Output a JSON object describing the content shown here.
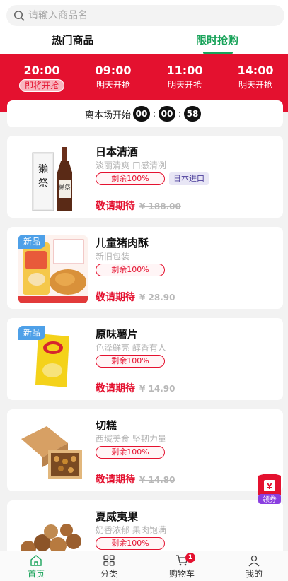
{
  "search": {
    "placeholder": "请输入商品名"
  },
  "tabs": [
    {
      "label": "热门商品"
    },
    {
      "label": "限时抢购"
    }
  ],
  "slots": [
    {
      "time": "20:00",
      "status": "即将开抢"
    },
    {
      "time": "09:00",
      "status": "明天开抢"
    },
    {
      "time": "11:00",
      "status": "明天开抢"
    },
    {
      "time": "14:00",
      "status": "明天开抢"
    }
  ],
  "countdown": {
    "label": "离本场开始",
    "hh": "00",
    "mm": "00",
    "ss": "58",
    "sep": ":"
  },
  "products": [
    {
      "name": "日本清酒",
      "desc": "淡丽清爽 口感清冽",
      "remain": "剩余100%",
      "extra_tag": "日本进口",
      "new_badge": "",
      "wait": "敬请期待",
      "price": "¥ 188.00"
    },
    {
      "name": "儿童猪肉酥",
      "desc": "新旧包装",
      "remain": "剩余100%",
      "extra_tag": "",
      "new_badge": "新品",
      "wait": "敬请期待",
      "price": "¥ 28.90"
    },
    {
      "name": "原味薯片",
      "desc": "色泽鲜亮 醇香有人",
      "remain": "剩余100%",
      "extra_tag": "",
      "new_badge": "新品",
      "wait": "敬请期待",
      "price": "¥ 14.90"
    },
    {
      "name": "切糕",
      "desc": "西域美食 坚韧力量",
      "remain": "剩余100%",
      "extra_tag": "",
      "new_badge": "",
      "wait": "敬请期待",
      "price": "¥ 14.80"
    },
    {
      "name": "夏威夷果",
      "desc": "奶香浓郁 果肉饱满",
      "remain": "剩余100%",
      "extra_tag": "",
      "new_badge": "",
      "wait": "",
      "price": ""
    }
  ],
  "coupon": {
    "label": "领券",
    "symbol": "¥"
  },
  "nav": [
    {
      "label": "首页",
      "icon": "home-icon"
    },
    {
      "label": "分类",
      "icon": "category-icon"
    },
    {
      "label": "购物车",
      "icon": "cart-icon",
      "badge": "1"
    },
    {
      "label": "我的",
      "icon": "user-icon"
    }
  ],
  "colors": {
    "brand_red": "#e4112f",
    "accent_green": "#19a35a"
  }
}
